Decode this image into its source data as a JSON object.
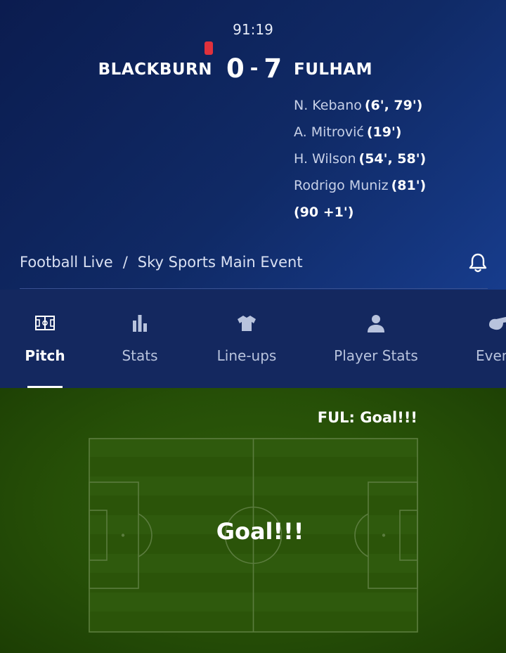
{
  "match": {
    "clock": "91:19",
    "home_team": "BLACKBURN",
    "home_score": "0",
    "separator": "-",
    "away_score": "7",
    "away_team": "FULHAM",
    "red_card_color": "#e0313c",
    "away_scorers": [
      {
        "name": "N. Kebano",
        "minutes": "(6', 79')"
      },
      {
        "name": "A. Mitrović",
        "minutes": "(19')"
      },
      {
        "name": "H. Wilson",
        "minutes": "(54', 58')"
      },
      {
        "name": "Rodrigo Muniz",
        "minutes": "(81')"
      },
      {
        "name": "",
        "minutes": "(90 +1')"
      }
    ]
  },
  "breadcrumb": {
    "section": "Football Live",
    "separator": "/",
    "channel": "Sky Sports Main Event",
    "bell_icon": "bell-icon"
  },
  "tabs": [
    {
      "label": "Pitch",
      "icon": "pitch-icon",
      "active": true
    },
    {
      "label": "Stats",
      "icon": "bar-chart-icon",
      "active": false
    },
    {
      "label": "Line-ups",
      "icon": "shirt-icon",
      "active": false
    },
    {
      "label": "Player Stats",
      "icon": "person-icon",
      "active": false
    },
    {
      "label": "Even",
      "icon": "whistle-icon",
      "active": false
    }
  ],
  "pitch_view": {
    "event_title": "FUL: Goal!!!",
    "center_text": "Goal!!!"
  },
  "colors": {
    "header_dark": "#0b1c4f",
    "header_light": "#173c8c",
    "tabs_bg": "#14285f",
    "pitch_green": "#2f5c0c"
  }
}
